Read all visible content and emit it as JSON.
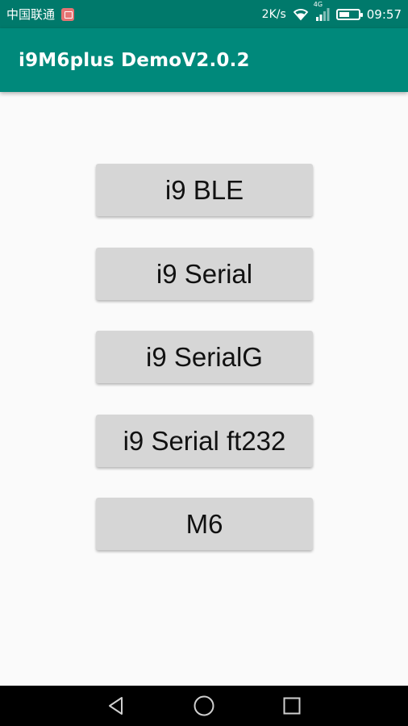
{
  "status_bar": {
    "carrier": "中国联通",
    "network_speed": "2K/s",
    "network_type": "4G",
    "time": "09:57",
    "icons": [
      "notification-icon",
      "wifi-icon",
      "signal-icon",
      "battery-icon"
    ]
  },
  "app_bar": {
    "title": "i9M6plus DemoV2.0.2",
    "color": "#00897b"
  },
  "buttons": [
    {
      "label": "i9 BLE"
    },
    {
      "label": "i9 Serial"
    },
    {
      "label": "i9 SerialG"
    },
    {
      "label": "i9 Serial ft232"
    },
    {
      "label": "M6"
    }
  ],
  "nav_bar": {
    "icons": [
      "back-icon",
      "home-icon",
      "recents-icon"
    ]
  },
  "colors": {
    "status_bar": "#00796b",
    "app_bar": "#00897b",
    "button_bg": "#d6d6d6",
    "background": "#fafafa"
  }
}
